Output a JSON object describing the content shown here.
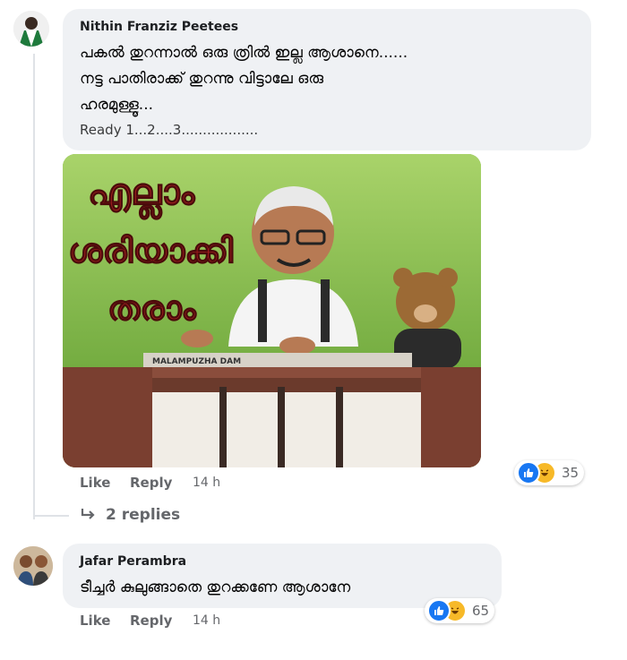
{
  "comments": [
    {
      "author": "Nithin Franziz Peetees",
      "lines": [
        "പകൽ തുറന്നാൽ ഒരു ത്രിൽ ഇല്ല ആശാനെ......",
        "നട്ട പാതിരാക്ക് തുറന്നു വിട്ടാലേ ഒരു",
        "ഹരമുള്ളൂ..."
      ],
      "ready": "Ready 1...2....3..................",
      "meme_text": [
        "എല്ലാം",
        "ശരിയാക്കി",
        "തരാം"
      ],
      "meme_sign": "MALAMPUZHA DAM",
      "like": "Like",
      "reply": "Reply",
      "time": "14 h",
      "reaction_count": "35",
      "replies_link": "2 replies"
    },
    {
      "author": "Jafar Perambra",
      "text": "ടീച്ചർ കുലുങ്ങാതെ തുറക്കണേ ആശാനേ",
      "like": "Like",
      "reply": "Reply",
      "time": "14 h",
      "reaction_count": "65"
    }
  ],
  "colors": {
    "bubble": "#eff1f4",
    "meta": "#65676b",
    "like_blue": "#1877f2",
    "haha_yellow": "#f7b928"
  },
  "icons": [
    "like-reaction-icon",
    "haha-reaction-icon",
    "reply-arrow-icon"
  ]
}
